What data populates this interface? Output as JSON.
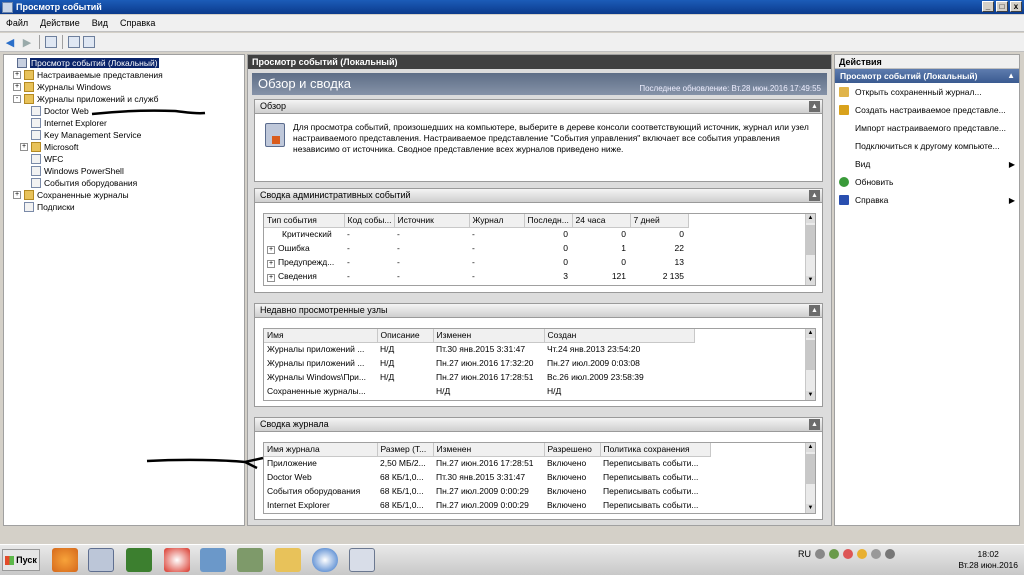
{
  "window": {
    "title": "Просмотр событий"
  },
  "menu": [
    "Файл",
    "Действие",
    "Вид",
    "Справка"
  ],
  "tree": [
    {
      "label": "Просмотр событий (Локальный)",
      "indent": 0,
      "exp": "",
      "icon": "root",
      "selected": true
    },
    {
      "label": "Настраиваемые представления",
      "indent": 1,
      "exp": "+",
      "icon": "folder"
    },
    {
      "label": "Журналы Windows",
      "indent": 1,
      "exp": "+",
      "icon": "folder"
    },
    {
      "label": "Журналы приложений и служб",
      "indent": 1,
      "exp": "−",
      "icon": "folder"
    },
    {
      "label": "Doctor Web",
      "indent": 2,
      "exp": "",
      "icon": "log"
    },
    {
      "label": "Internet Explorer",
      "indent": 2,
      "exp": "",
      "icon": "log"
    },
    {
      "label": "Key Management Service",
      "indent": 2,
      "exp": "",
      "icon": "log"
    },
    {
      "label": "Microsoft",
      "indent": 2,
      "exp": "+",
      "icon": "folder"
    },
    {
      "label": "WFC",
      "indent": 2,
      "exp": "",
      "icon": "log"
    },
    {
      "label": "Windows PowerShell",
      "indent": 2,
      "exp": "",
      "icon": "log"
    },
    {
      "label": "События оборудования",
      "indent": 2,
      "exp": "",
      "icon": "log"
    },
    {
      "label": "Сохраненные журналы",
      "indent": 1,
      "exp": "+",
      "icon": "folder"
    },
    {
      "label": "Подписки",
      "indent": 1,
      "exp": "",
      "icon": "log"
    }
  ],
  "center": {
    "header": "Просмотр событий (Локальный)",
    "banner_title": "Обзор и сводка",
    "last_update": "Последнее обновление: Вт.28 июн.2016 17:49:55",
    "overview": {
      "title": "Обзор",
      "text": "Для просмотра событий, произошедших на компьютере, выберите в дереве консоли соответствующий источник, журнал или узел настраиваемого представления. Настраиваемое представление \"События управления\" включает все события управления независимо от источника. Сводное представление всех журналов приведено ниже."
    },
    "admin_summary": {
      "title": "Сводка административных событий",
      "columns": [
        "Тип события",
        "Код собы...",
        "Источник",
        "Журнал",
        "Последн...",
        "24 часа",
        "7 дней"
      ],
      "rows": [
        {
          "exp": false,
          "cells": [
            "Критический",
            "-",
            "-",
            "-",
            "0",
            "0",
            "0"
          ]
        },
        {
          "exp": true,
          "cells": [
            "Ошибка",
            "-",
            "-",
            "-",
            "0",
            "1",
            "22"
          ]
        },
        {
          "exp": true,
          "cells": [
            "Предупрежд...",
            "-",
            "-",
            "-",
            "0",
            "0",
            "13"
          ]
        },
        {
          "exp": true,
          "cells": [
            "Сведения",
            "-",
            "-",
            "-",
            "3",
            "121",
            "2 135"
          ]
        }
      ]
    },
    "recent_nodes": {
      "title": "Недавно просмотренные узлы",
      "columns": [
        "Имя",
        "Описание",
        "Изменен",
        "Создан"
      ],
      "rows": [
        [
          "Журналы приложений ...",
          "Н/Д",
          "Пт.30 янв.2015 3:31:47",
          "Чт.24 янв.2013 23:54:20"
        ],
        [
          "Журналы приложений ...",
          "Н/Д",
          "Пн.27 июн.2016 17:32:20",
          "Пн.27 июл.2009 0:03:08"
        ],
        [
          "Журналы Windows\\При...",
          "Н/Д",
          "Пн.27 июн.2016 17:28:51",
          "Вс.26 июл.2009 23:58:39"
        ],
        [
          "Сохраненные журналы...",
          "",
          "Н/Д",
          "Н/Д"
        ]
      ]
    },
    "log_summary": {
      "title": "Сводка журнала",
      "columns": [
        "Имя журнала",
        "Размер (Т...",
        "Изменен",
        "Разрешено",
        "Политика сохранения"
      ],
      "rows": [
        [
          "Приложение",
          "2,50 МБ/2...",
          "Пн.27 июн.2016 17:28:51",
          "Включено",
          "Переписывать событи..."
        ],
        [
          "Doctor Web",
          "68 КБ/1,0...",
          "Пт.30 янв.2015 3:31:47",
          "Включено",
          "Переписывать событи..."
        ],
        [
          "События оборудования",
          "68 КБ/1,0...",
          "Пн.27 июл.2009 0:00:29",
          "Включено",
          "Переписывать событи..."
        ],
        [
          "Internet Explorer",
          "68 КБ/1,0...",
          "Пн.27 июл.2009 0:00:29",
          "Включено",
          "Переписывать событи..."
        ]
      ]
    }
  },
  "actions": {
    "header": "Действия",
    "subheader": "Просмотр событий (Локальный)",
    "items": [
      {
        "label": "Открыть сохраненный журнал...",
        "icon": "open-folder-icon",
        "color": "#e0b44a",
        "submenu": false
      },
      {
        "label": "Создать настраиваемое представле...",
        "icon": "filter-icon",
        "color": "#d9a21c",
        "submenu": false
      },
      {
        "label": "Импорт настраиваемого представле...",
        "icon": "",
        "color": "",
        "submenu": false
      },
      {
        "label": "Подключиться к другому компьюте...",
        "icon": "",
        "color": "",
        "submenu": false
      },
      {
        "label": "Вид",
        "icon": "",
        "color": "",
        "submenu": true
      },
      {
        "label": "Обновить",
        "icon": "refresh-icon",
        "color": "#3a9a3a",
        "submenu": false
      },
      {
        "label": "Справка",
        "icon": "help-icon",
        "color": "#2a4fb0",
        "submenu": true
      }
    ]
  },
  "taskbar": {
    "start": "Пуск",
    "lang": "RU",
    "time": "18:02",
    "date": "Вт.28 июн.2016"
  }
}
